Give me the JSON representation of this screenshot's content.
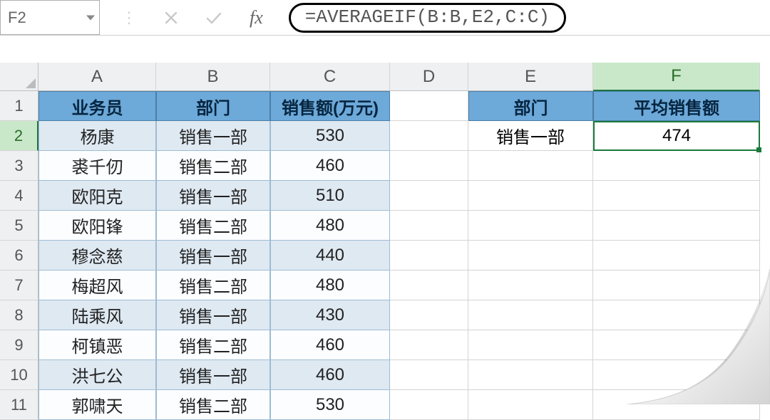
{
  "name_box": "F2",
  "formula": "=AVERAGEIF(B:B,E2,C:C)",
  "fx_label": "fx",
  "columns": [
    "A",
    "B",
    "C",
    "D",
    "E",
    "F"
  ],
  "rows": [
    "1",
    "2",
    "3",
    "4",
    "5",
    "6",
    "7",
    "8",
    "9",
    "10",
    "11"
  ],
  "headers_left": {
    "A": "业务员",
    "B": "部门",
    "C": "销售额(万元)"
  },
  "headers_right": {
    "E": "部门",
    "F": "平均销售额"
  },
  "right_data": {
    "E2": "销售一部",
    "F2": "474"
  },
  "data": [
    {
      "name": "杨康",
      "dept": "销售一部",
      "sales": "530"
    },
    {
      "name": "裘千仞",
      "dept": "销售二部",
      "sales": "460"
    },
    {
      "name": "欧阳克",
      "dept": "销售一部",
      "sales": "510"
    },
    {
      "name": "欧阳锋",
      "dept": "销售二部",
      "sales": "480"
    },
    {
      "name": "穆念慈",
      "dept": "销售一部",
      "sales": "440"
    },
    {
      "name": "梅超风",
      "dept": "销售二部",
      "sales": "480"
    },
    {
      "name": "陆乘风",
      "dept": "销售一部",
      "sales": "430"
    },
    {
      "name": "柯镇恶",
      "dept": "销售二部",
      "sales": "460"
    },
    {
      "name": "洪七公",
      "dept": "销售一部",
      "sales": "460"
    },
    {
      "name": "郭啸天",
      "dept": "销售二部",
      "sales": "530"
    }
  ],
  "active_cell": "F2",
  "selected_col": "F",
  "selected_row": "2"
}
